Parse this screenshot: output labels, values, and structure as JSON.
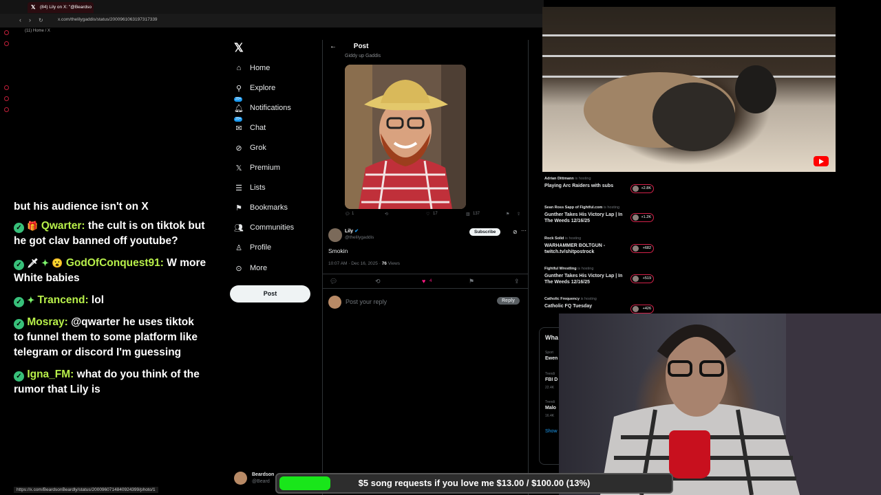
{
  "browser": {
    "tab_title": "(84) Lily on X: \"@Beardso",
    "url": "x.com/thelilygaddis/status/2000961063197317339",
    "bookmark": "(11) Home / X",
    "status_url": "https://x.com/BeardsonBeardly/status/2000960714840924399/photo/1"
  },
  "chat": [
    {
      "user": "",
      "text": "but his audience isn't on X",
      "color": "#ffffff"
    },
    {
      "user": "Qwarter:",
      "text": "the cult is on tiktok but he got clav banned off youtube?",
      "color": "#b8f04a"
    },
    {
      "user": "GodOfConquest91:",
      "text": "W more White babies",
      "color": "#b8f04a"
    },
    {
      "user": "Trancend:",
      "text": "lol",
      "color": "#b8f04a"
    },
    {
      "user": "Mosray:",
      "text": "@qwarter he uses tiktok to funnel them to some platform like telegram or discord I'm guessing",
      "color": "#b8f04a"
    },
    {
      "user": "Igna_FM:",
      "text": "what do you think of the rumor that Lily is",
      "color": "#b8f04a"
    }
  ],
  "sidebar": {
    "items": [
      {
        "label": "Home",
        "icon": "home-icon"
      },
      {
        "label": "Explore",
        "icon": "search-icon"
      },
      {
        "label": "Notifications",
        "icon": "bell-icon",
        "count": "20+"
      },
      {
        "label": "Chat",
        "icon": "mail-icon",
        "count": "20+"
      },
      {
        "label": "Grok",
        "icon": "grok-icon"
      },
      {
        "label": "Premium",
        "icon": "x-icon"
      },
      {
        "label": "Lists",
        "icon": "list-icon"
      },
      {
        "label": "Bookmarks",
        "icon": "bookmark-icon"
      },
      {
        "label": "Communities",
        "icon": "people-icon"
      },
      {
        "label": "Profile",
        "icon": "person-icon"
      },
      {
        "label": "More",
        "icon": "more-icon"
      }
    ],
    "post_button": "Post",
    "account_name": "Beardson",
    "account_handle": "@Beard"
  },
  "post": {
    "header": "Post",
    "quote_name": "Giddy up Gaddis",
    "quote_reply_count": "1",
    "quote_like_count": "17",
    "quote_views": "137",
    "author_name": "Lily",
    "author_handle": "@thelilygaddis",
    "subscribe_label": "Subscribe",
    "text": "Smokin",
    "time": "10:07 AM · Dec 16, 2025 · ",
    "views_count": "76",
    "views_label": " Views",
    "like_count": "4",
    "reply_placeholder": "Post your reply",
    "reply_button": "Reply"
  },
  "live": [
    {
      "host": "Adrian Dittmann",
      "status": "is hosting",
      "title": "Playing Arc Raiders with subs",
      "count": "+2.8K"
    },
    {
      "host": "Sean Ross Sapp of Fightful.com",
      "status": "is hosting",
      "title": "Gunther Takes His Victory Lap | In The Weeds 12/16/25",
      "count": "+1.2K"
    },
    {
      "host": "Rock Solid",
      "status": "is hosting",
      "title": "WARHAMMER BOLTGUN - twitch.tv/shitpostrock",
      "count": "+682"
    },
    {
      "host": "Fightful Wrestling",
      "status": "is hosting",
      "title": "Gunther Takes His Victory Lap | In The Weeds 12/16/25",
      "count": "+519"
    },
    {
      "host": "Catholic Frequency",
      "status": "is hosting",
      "title": "Catholic FQ Tuesday",
      "count": "+426"
    }
  ],
  "trends": {
    "heading": "Wha",
    "items": [
      {
        "sub": "Sport",
        "title": "Ewen"
      },
      {
        "sub": "Trendi",
        "title": "FBI D",
        "posts": "22.4K"
      },
      {
        "sub": "Trendi",
        "title": "Malo",
        "posts": "16.4K"
      }
    ],
    "show": "Show"
  },
  "goal": {
    "text": "$5 song requests if you love me $13.00 / $100.00 (13%)",
    "progress": 0.13,
    "color": "#19e61a"
  },
  "colors": {
    "accent": "#1d9bf0",
    "live": "#d4224a",
    "like": "#f91880"
  }
}
